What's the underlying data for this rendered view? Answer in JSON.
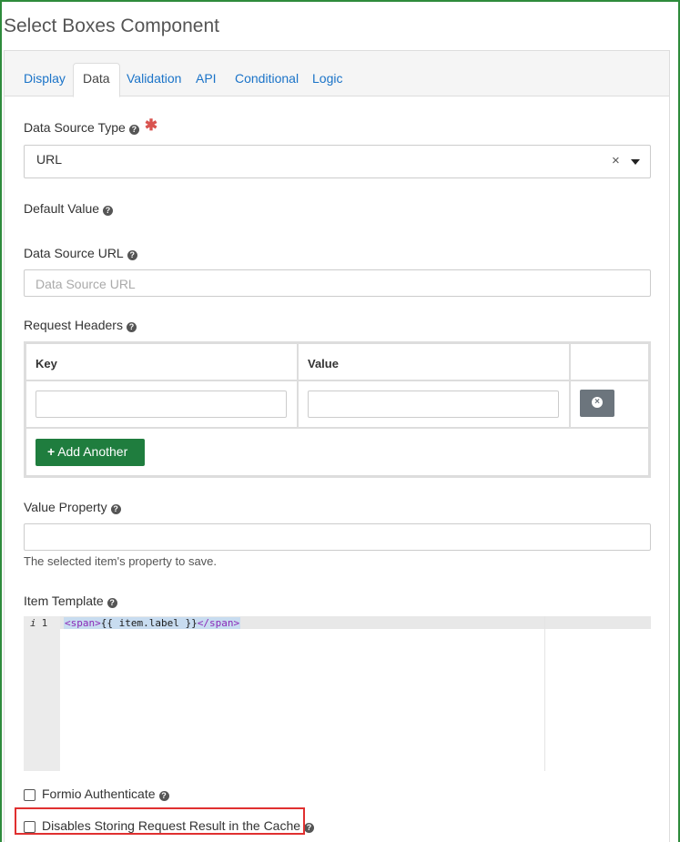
{
  "header": {
    "title": "Select Boxes Component"
  },
  "tabs": [
    "Display",
    "Data",
    "Validation",
    "API",
    "Conditional",
    "Logic"
  ],
  "active_tab": "Data",
  "fields": {
    "data_source_type": {
      "label": "Data Source Type",
      "value": "URL",
      "clear_symbol": "×"
    },
    "default_value": {
      "label": "Default Value"
    },
    "data_source_url": {
      "label": "Data Source URL",
      "placeholder": "Data Source URL"
    },
    "request_headers": {
      "label": "Request Headers",
      "columns": [
        "Key",
        "Value"
      ],
      "add_label": "Add Another"
    },
    "value_property": {
      "label": "Value Property",
      "hint": "The selected item's property to save."
    },
    "item_template": {
      "label": "Item Template",
      "gutter_info": "i",
      "line_number": "1",
      "code_open_tag": "<span>",
      "code_expr": "{{ item.label }}",
      "code_close_tag": "</span>"
    },
    "formio_authenticate": {
      "label": "Formio Authenticate"
    },
    "disable_cache": {
      "label": "Disables Storing Request Result in the Cache"
    }
  },
  "colors": {
    "accent_green": "#1f7d3e",
    "link_blue": "#1a73c8",
    "highlight_red": "#e03030",
    "required_red": "#d9534f"
  },
  "icons": [
    "help-icon",
    "required-asterisk",
    "clear-icon",
    "dropdown-caret-icon",
    "remove-circle-icon",
    "plus-icon",
    "checkbox"
  ]
}
